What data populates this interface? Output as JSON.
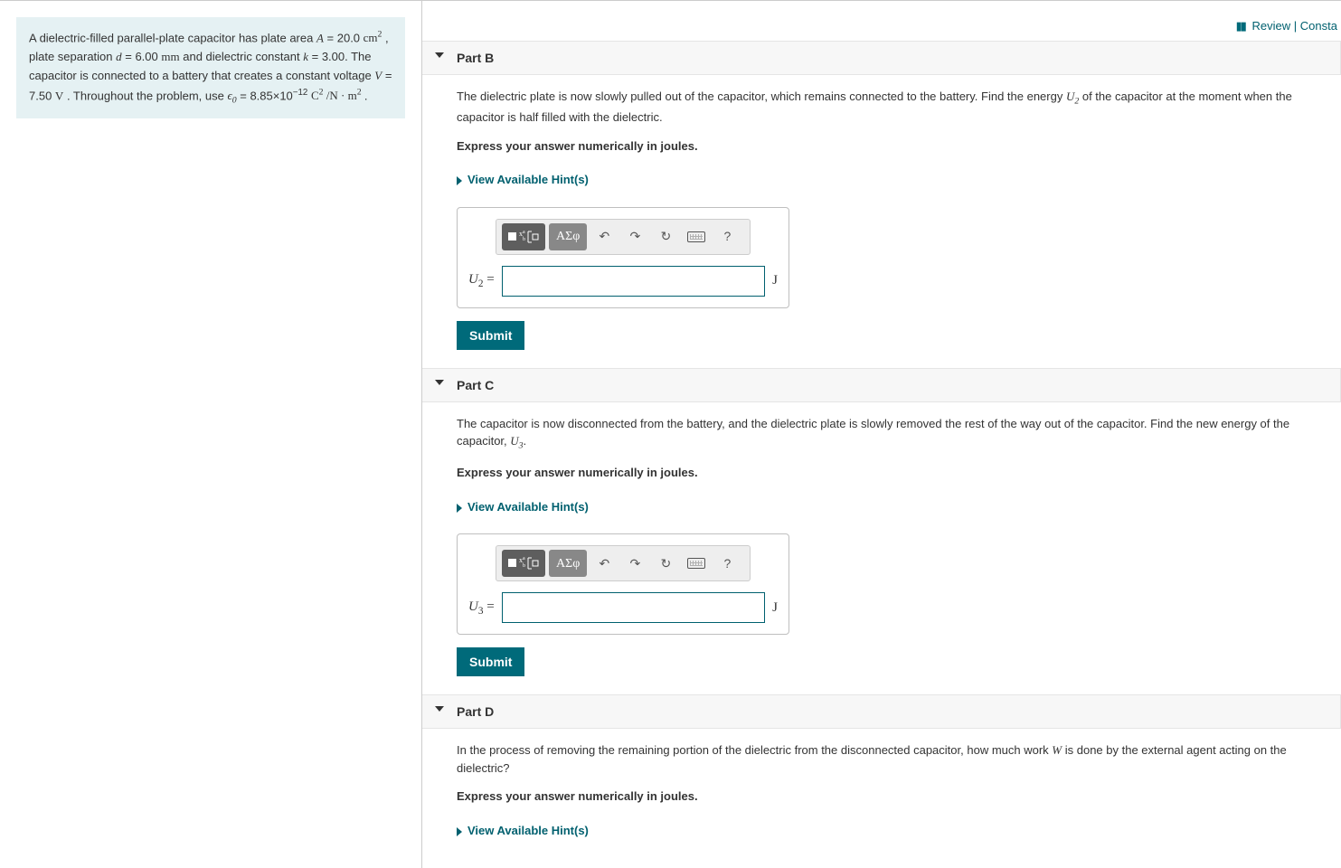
{
  "topbar": {
    "review": "Review",
    "constants": "Consta"
  },
  "problem": {
    "t1": "A dielectric-filled parallel-plate capacitor has plate area ",
    "A_sym": "A",
    "A_eq": " = 20.0 ",
    "A_unit_base": "cm",
    "A_unit_exp": "2",
    "t2": " , plate separation ",
    "d_sym": "d",
    "d_eq": " = 6.00 ",
    "d_unit": "mm",
    "t3": " and dielectric constant ",
    "k_sym": "k",
    "k_eq": " = 3.00. The capacitor is connected to a battery that creates a constant voltage ",
    "V_sym": "V",
    "V_eq": " = 7.50 ",
    "V_unit": "V",
    "t4": " . Throughout the problem, use ",
    "eps_sym": "ϵ",
    "eps_sub": "0",
    "eps_eq": " = 8.85×10",
    "eps_exp": "−12",
    "eps_unit_num_base": "C",
    "eps_unit_num_exp": "2",
    "eps_unit_slash": " /",
    "eps_unit_den1": "N",
    "eps_unit_dot": " · ",
    "eps_unit_den2_base": "m",
    "eps_unit_den2_exp": "2",
    "t5": " ."
  },
  "partB": {
    "title": "Part B",
    "q_a": "The dielectric plate is now slowly pulled out of the capacitor, which remains connected to the battery. Find the energy ",
    "q_var": "U",
    "q_sub": "2",
    "q_b": " of the capacitor at the moment when the capacitor is half filled with the dielectric.",
    "express": "Express your answer numerically in joules.",
    "hints": "View Available Hint(s)",
    "var": "U",
    "var_sub": "2",
    "equals": " = ",
    "unit": "J",
    "submit": "Submit"
  },
  "partC": {
    "title": "Part C",
    "q_a": "The capacitor is now disconnected from the battery, and the dielectric plate is slowly removed the rest of the way out of the capacitor. Find the new energy of the capacitor, ",
    "q_var": "U",
    "q_sub": "3",
    "q_b": ".",
    "express": "Express your answer numerically in joules.",
    "hints": "View Available Hint(s)",
    "var": "U",
    "var_sub": "3",
    "equals": " = ",
    "unit": "J",
    "submit": "Submit"
  },
  "partD": {
    "title": "Part D",
    "q_a": "In the process of removing the remaining portion of the dielectric from the disconnected capacitor, how much work ",
    "q_var": "W",
    "q_b": " is done by the external agent acting on the dielectric?",
    "express": "Express your answer numerically in joules.",
    "hints": "View Available Hint(s)"
  },
  "toolbar": {
    "greek": "ΑΣφ",
    "help": "?"
  }
}
